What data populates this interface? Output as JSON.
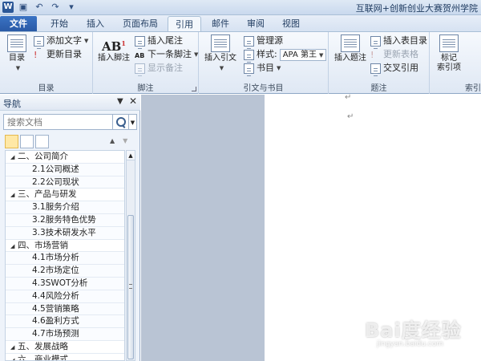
{
  "titlebar": {
    "app_icon": "W",
    "title": "互联网+创新创业大赛贺州学院",
    "qat_icons": [
      "save-icon",
      "undo-icon",
      "redo-icon"
    ]
  },
  "tabs": {
    "file": "文件",
    "home": "开始",
    "insert": "插入",
    "layout": "页面布局",
    "references": "引用",
    "mailings": "邮件",
    "review": "审阅",
    "view": "视图"
  },
  "ribbon": {
    "toc": {
      "label": "目录",
      "toc_button": "目录",
      "add_text": "添加文字",
      "update_toc": "更新目录"
    },
    "footnotes": {
      "label": "脚注",
      "insert_footnote": "插入脚注",
      "insert_endnote": "插入尾注",
      "next_footnote": "下一条脚注",
      "show_notes": "显示备注",
      "ab_glyph": "AB"
    },
    "citations": {
      "label": "引文与书目",
      "insert_citation": "插入引文",
      "manage_sources": "管理源",
      "style_label": "样式:",
      "style_value": "APA 第王",
      "bibliography": "书目"
    },
    "captions": {
      "label": "题注",
      "insert_caption": "插入题注",
      "insert_table_of_figures": "插入表目录",
      "update_table": "更新表格",
      "cross_reference": "交叉引用"
    },
    "index": {
      "label": "索引",
      "mark_entry_line1": "标记",
      "mark_entry_line2": "索引项"
    }
  },
  "nav": {
    "title": "导航",
    "search_placeholder": "搜索文档",
    "items": [
      {
        "level": 1,
        "text": "二、公司简介"
      },
      {
        "level": 2,
        "text": "2.1公司概述"
      },
      {
        "level": 2,
        "text": "2.2公司现状"
      },
      {
        "level": 1,
        "text": "三、产品与研发"
      },
      {
        "level": 2,
        "text": "3.1服务介绍"
      },
      {
        "level": 2,
        "text": "3.2服务特色优势"
      },
      {
        "level": 2,
        "text": "3.3技术研发水平"
      },
      {
        "level": 1,
        "text": "四、市场营销"
      },
      {
        "level": 2,
        "text": "4.1市场分析"
      },
      {
        "level": 2,
        "text": "4.2市场定位"
      },
      {
        "level": 2,
        "text": "4.3SWOT分析"
      },
      {
        "level": 2,
        "text": "4.4风险分析"
      },
      {
        "level": 2,
        "text": "4.5营销策略"
      },
      {
        "level": 2,
        "text": "4.6盈利方式"
      },
      {
        "level": 2,
        "text": "4.7市场预测"
      },
      {
        "level": 1,
        "text": "五、发展战略"
      },
      {
        "level": 1,
        "text": "六、商业模式"
      }
    ]
  },
  "document": {
    "para_mark": "↵"
  },
  "watermark": {
    "brand": "Bai度经验",
    "url": "jingyan.baidu.com"
  }
}
